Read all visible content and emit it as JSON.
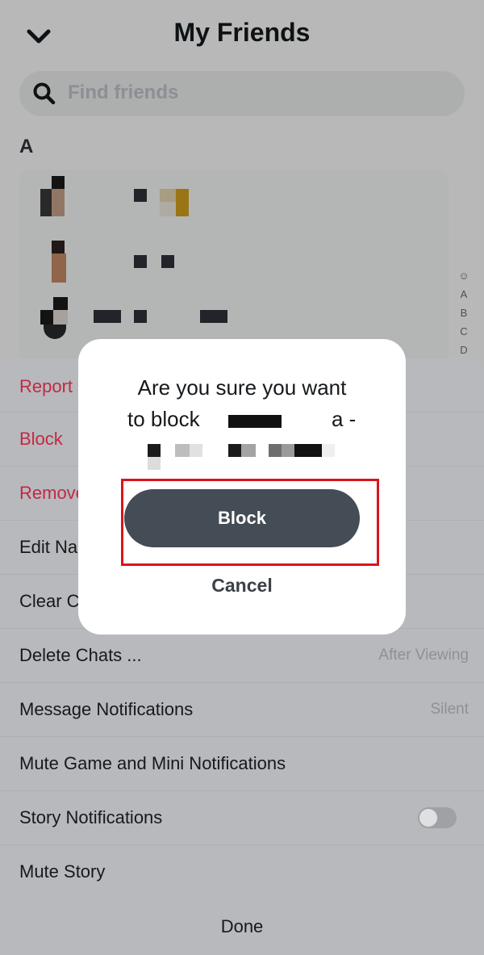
{
  "header": {
    "title": "My Friends",
    "back_icon": "chevron-down-icon"
  },
  "search": {
    "placeholder": "Find friends",
    "icon": "search-icon"
  },
  "friends": {
    "section_letter": "A"
  },
  "alpha_index": [
    "☺",
    "A",
    "B",
    "C",
    "D"
  ],
  "sheet": {
    "items": [
      {
        "label": "Report",
        "color": "red"
      },
      {
        "label": "Block",
        "color": "red"
      },
      {
        "label": "Remove",
        "color": "red"
      },
      {
        "label": "Edit Na",
        "color": "default"
      },
      {
        "label": "Clear C",
        "color": "default"
      },
      {
        "label": "Delete Chats ...",
        "value": "After Viewing"
      },
      {
        "label": "Message Notifications",
        "value": "Silent"
      },
      {
        "label": "Mute Game and Mini Notifications"
      },
      {
        "label": "Story Notifications",
        "toggle": false
      },
      {
        "label": "Mute Story"
      }
    ],
    "done_label": "Done"
  },
  "dialog": {
    "line1": "Are you sure you want",
    "line2_prefix": "to block",
    "line2_suffix": "a -",
    "block_label": "Block",
    "cancel_label": "Cancel"
  },
  "colors": {
    "destructive": "#c02a44",
    "primary_button": "#444c56",
    "highlight": "#d9151b"
  }
}
